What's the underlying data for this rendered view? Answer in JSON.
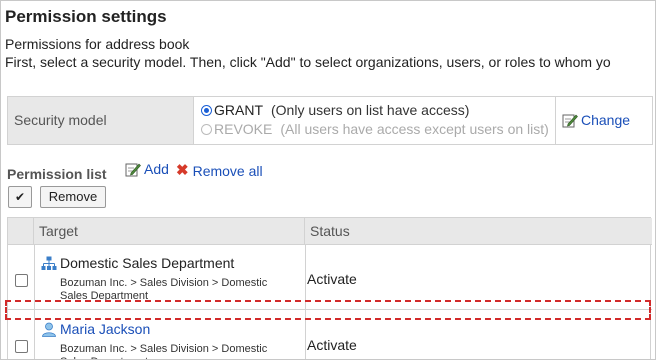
{
  "page": {
    "title": "Permission settings",
    "subtitle": "Permissions for address book",
    "instruction": "First, select a security model. Then, click \"Add\" to select organizations, users, or roles to whom yo"
  },
  "security_model": {
    "label": "Security model",
    "options": [
      {
        "label": "GRANT",
        "note": "(Only users on list have access)",
        "selected": true,
        "enabled": true
      },
      {
        "label": "REVOKE",
        "note": "(All users have access except users on list)",
        "selected": false,
        "enabled": false
      }
    ],
    "change_label": "Change"
  },
  "permission_list": {
    "heading": "Permission list",
    "add_label": "Add",
    "remove_all_label": "Remove all",
    "select_all_glyph": "✔",
    "remove_label": "Remove",
    "columns": {
      "target": "Target",
      "status": "Status"
    },
    "rows": [
      {
        "icon": "organization-icon",
        "name": "Domestic Sales Department",
        "path": "Bozuman Inc. > Sales Division > Domestic Sales Department",
        "status": "Activate",
        "is_link": false
      },
      {
        "icon": "user-icon",
        "name": "Maria Jackson",
        "path": "Bozuman Inc. > Sales Division > Domestic Sales Department",
        "status": "Activate",
        "is_link": true
      }
    ]
  },
  "colors": {
    "link": "#1a4fb8",
    "highlight_dash": "#d22a2a",
    "header_bg": "#e8e8e8"
  }
}
